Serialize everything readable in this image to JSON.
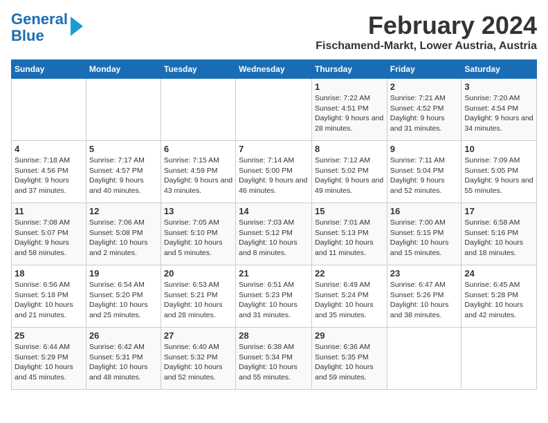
{
  "logo": {
    "line1": "General",
    "line2": "Blue"
  },
  "title": "February 2024",
  "subtitle": "Fischamend-Markt, Lower Austria, Austria",
  "days_of_week": [
    "Sunday",
    "Monday",
    "Tuesday",
    "Wednesday",
    "Thursday",
    "Friday",
    "Saturday"
  ],
  "weeks": [
    [
      {
        "day": "",
        "info": ""
      },
      {
        "day": "",
        "info": ""
      },
      {
        "day": "",
        "info": ""
      },
      {
        "day": "",
        "info": ""
      },
      {
        "day": "1",
        "info": "Sunrise: 7:22 AM\nSunset: 4:51 PM\nDaylight: 9 hours and 28 minutes."
      },
      {
        "day": "2",
        "info": "Sunrise: 7:21 AM\nSunset: 4:52 PM\nDaylight: 9 hours and 31 minutes."
      },
      {
        "day": "3",
        "info": "Sunrise: 7:20 AM\nSunset: 4:54 PM\nDaylight: 9 hours and 34 minutes."
      }
    ],
    [
      {
        "day": "4",
        "info": "Sunrise: 7:18 AM\nSunset: 4:56 PM\nDaylight: 9 hours and 37 minutes."
      },
      {
        "day": "5",
        "info": "Sunrise: 7:17 AM\nSunset: 4:57 PM\nDaylight: 9 hours and 40 minutes."
      },
      {
        "day": "6",
        "info": "Sunrise: 7:15 AM\nSunset: 4:59 PM\nDaylight: 9 hours and 43 minutes."
      },
      {
        "day": "7",
        "info": "Sunrise: 7:14 AM\nSunset: 5:00 PM\nDaylight: 9 hours and 46 minutes."
      },
      {
        "day": "8",
        "info": "Sunrise: 7:12 AM\nSunset: 5:02 PM\nDaylight: 9 hours and 49 minutes."
      },
      {
        "day": "9",
        "info": "Sunrise: 7:11 AM\nSunset: 5:04 PM\nDaylight: 9 hours and 52 minutes."
      },
      {
        "day": "10",
        "info": "Sunrise: 7:09 AM\nSunset: 5:05 PM\nDaylight: 9 hours and 55 minutes."
      }
    ],
    [
      {
        "day": "11",
        "info": "Sunrise: 7:08 AM\nSunset: 5:07 PM\nDaylight: 9 hours and 58 minutes."
      },
      {
        "day": "12",
        "info": "Sunrise: 7:06 AM\nSunset: 5:08 PM\nDaylight: 10 hours and 2 minutes."
      },
      {
        "day": "13",
        "info": "Sunrise: 7:05 AM\nSunset: 5:10 PM\nDaylight: 10 hours and 5 minutes."
      },
      {
        "day": "14",
        "info": "Sunrise: 7:03 AM\nSunset: 5:12 PM\nDaylight: 10 hours and 8 minutes."
      },
      {
        "day": "15",
        "info": "Sunrise: 7:01 AM\nSunset: 5:13 PM\nDaylight: 10 hours and 11 minutes."
      },
      {
        "day": "16",
        "info": "Sunrise: 7:00 AM\nSunset: 5:15 PM\nDaylight: 10 hours and 15 minutes."
      },
      {
        "day": "17",
        "info": "Sunrise: 6:58 AM\nSunset: 5:16 PM\nDaylight: 10 hours and 18 minutes."
      }
    ],
    [
      {
        "day": "18",
        "info": "Sunrise: 6:56 AM\nSunset: 5:18 PM\nDaylight: 10 hours and 21 minutes."
      },
      {
        "day": "19",
        "info": "Sunrise: 6:54 AM\nSunset: 5:20 PM\nDaylight: 10 hours and 25 minutes."
      },
      {
        "day": "20",
        "info": "Sunrise: 6:53 AM\nSunset: 5:21 PM\nDaylight: 10 hours and 28 minutes."
      },
      {
        "day": "21",
        "info": "Sunrise: 6:51 AM\nSunset: 5:23 PM\nDaylight: 10 hours and 31 minutes."
      },
      {
        "day": "22",
        "info": "Sunrise: 6:49 AM\nSunset: 5:24 PM\nDaylight: 10 hours and 35 minutes."
      },
      {
        "day": "23",
        "info": "Sunrise: 6:47 AM\nSunset: 5:26 PM\nDaylight: 10 hours and 38 minutes."
      },
      {
        "day": "24",
        "info": "Sunrise: 6:45 AM\nSunset: 5:28 PM\nDaylight: 10 hours and 42 minutes."
      }
    ],
    [
      {
        "day": "25",
        "info": "Sunrise: 6:44 AM\nSunset: 5:29 PM\nDaylight: 10 hours and 45 minutes."
      },
      {
        "day": "26",
        "info": "Sunrise: 6:42 AM\nSunset: 5:31 PM\nDaylight: 10 hours and 48 minutes."
      },
      {
        "day": "27",
        "info": "Sunrise: 6:40 AM\nSunset: 5:32 PM\nDaylight: 10 hours and 52 minutes."
      },
      {
        "day": "28",
        "info": "Sunrise: 6:38 AM\nSunset: 5:34 PM\nDaylight: 10 hours and 55 minutes."
      },
      {
        "day": "29",
        "info": "Sunrise: 6:36 AM\nSunset: 5:35 PM\nDaylight: 10 hours and 59 minutes."
      },
      {
        "day": "",
        "info": ""
      },
      {
        "day": "",
        "info": ""
      }
    ]
  ]
}
